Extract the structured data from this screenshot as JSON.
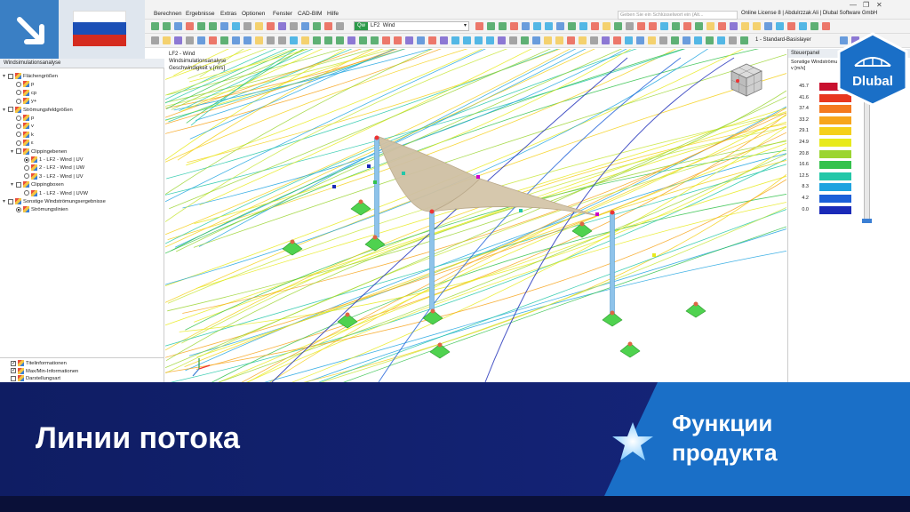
{
  "colors": {
    "accent_blue": "#1a6fc7",
    "banner_navy": "#0f1d63",
    "badge_blue": "#3a7fc4",
    "loadcase_green": "#2c9a4a"
  },
  "badge": {
    "arrow_icon": "arrow-down-right-icon",
    "flag_icon": "russia-flag-icon"
  },
  "menu": {
    "items": [
      "Berechnen",
      "Ergebnisse",
      "Extras",
      "Optionen",
      "Fenster",
      "CAD-BIM",
      "Hilfe"
    ],
    "search_placeholder": "Geben Sie ein Schlüsselwort ein (Alt...",
    "license": "Online License 8 | Abdulrzzak Ali | Dlubal Software GmbH"
  },
  "toolbar": {
    "loadcase_tag": "Qw",
    "loadcase_id": "LF2",
    "loadcase_name": "Wind",
    "layer": "1 - Standard-Basislayer"
  },
  "navigator": {
    "title": "Windsimulationsanalyse",
    "tree": [
      {
        "label": "Flächengrößen",
        "level": 0,
        "kind": "check",
        "checked": false,
        "expanded": true
      },
      {
        "label": "p",
        "level": 1,
        "kind": "radio",
        "checked": false
      },
      {
        "label": "cp",
        "level": 1,
        "kind": "radio",
        "checked": false
      },
      {
        "label": "y+",
        "level": 1,
        "kind": "radio",
        "checked": false
      },
      {
        "label": "Strömungsfeldgrößen",
        "level": 0,
        "kind": "check",
        "checked": false,
        "expanded": true
      },
      {
        "label": "p",
        "level": 1,
        "kind": "radio",
        "checked": false
      },
      {
        "label": "v",
        "level": 1,
        "kind": "radio",
        "checked": false
      },
      {
        "label": "k",
        "level": 1,
        "kind": "radio",
        "checked": false
      },
      {
        "label": "ε",
        "level": 1,
        "kind": "radio",
        "checked": false
      },
      {
        "label": "Clippingebenen",
        "level": 1,
        "kind": "check",
        "checked": false,
        "expanded": true
      },
      {
        "label": "1 - LF2 - Wind | UV",
        "level": 2,
        "kind": "radio",
        "checked": true
      },
      {
        "label": "2 - LF2 - Wind | UW",
        "level": 2,
        "kind": "radio",
        "checked": false
      },
      {
        "label": "3 - LF2 - Wind | UV",
        "level": 2,
        "kind": "radio",
        "checked": false
      },
      {
        "label": "Clippingboxen",
        "level": 1,
        "kind": "check",
        "checked": false,
        "expanded": true
      },
      {
        "label": "1 - LF2 - Wind | UVW",
        "level": 2,
        "kind": "radio",
        "checked": false
      },
      {
        "label": "Sonstige Windströmungsergebnisse",
        "level": 0,
        "kind": "check",
        "checked": false,
        "expanded": true
      },
      {
        "label": "Strömungslinien",
        "level": 1,
        "kind": "radio",
        "checked": true
      }
    ],
    "bottom": [
      {
        "label": "Titelinformationen",
        "checked": true
      },
      {
        "label": "Max/Min-Informationen",
        "checked": true
      },
      {
        "label": "Darstellungsart",
        "checked": false
      }
    ]
  },
  "viewport": {
    "line1": "LF2 - Wind",
    "line2": "Windsimulationsanalyse",
    "line3": "Geschwindigkeit v [m/s]"
  },
  "panel": {
    "title": "Steuerpanel",
    "subtitle1": "Sonstige Windströmu...",
    "subtitle2": "v [m/s]",
    "legend": [
      {
        "value": "45.7",
        "color": "#c8102e"
      },
      {
        "value": "41.6",
        "color": "#e8371f"
      },
      {
        "value": "37.4",
        "color": "#f47a1f"
      },
      {
        "value": "33.2",
        "color": "#f7a51c"
      },
      {
        "value": "29.1",
        "color": "#f5d01a"
      },
      {
        "value": "24.9",
        "color": "#e8ea1b"
      },
      {
        "value": "20.8",
        "color": "#9bd531"
      },
      {
        "value": "16.6",
        "color": "#34c24c"
      },
      {
        "value": "12.5",
        "color": "#23c7a8"
      },
      {
        "value": "8.3",
        "color": "#1ea3e0"
      },
      {
        "value": "4.2",
        "color": "#1b5fd8"
      },
      {
        "value": "0.0",
        "color": "#1a2ab8"
      }
    ]
  },
  "logo": {
    "text": "Dlubal"
  },
  "banner": {
    "title": "Линии потока",
    "subtitle_line1": "Функции",
    "subtitle_line2": "продукта",
    "star_icon": "star-icon"
  }
}
